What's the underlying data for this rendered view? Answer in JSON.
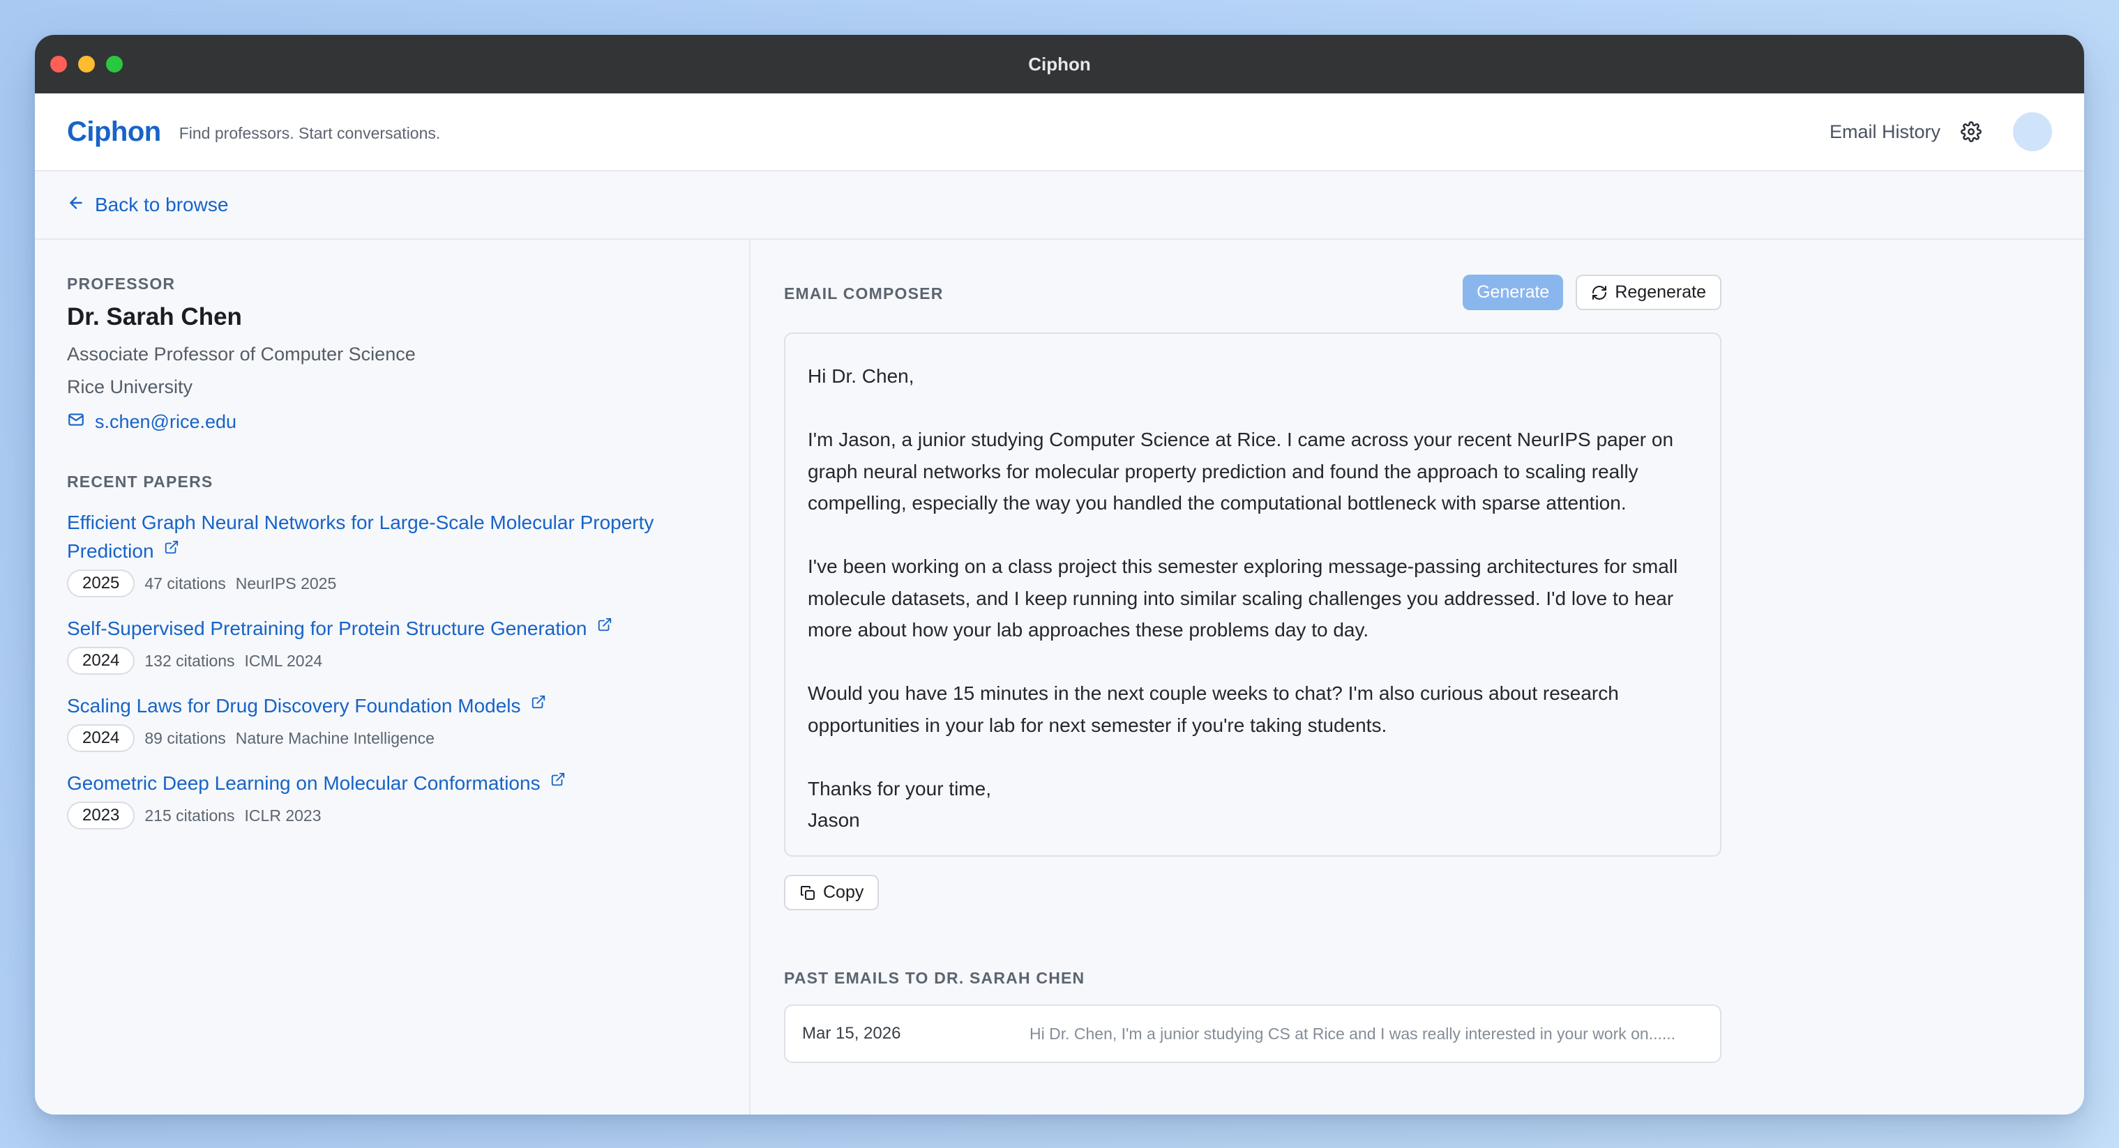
{
  "window": {
    "title": "Ciphon"
  },
  "header": {
    "brand": "Ciphon",
    "tagline": "Find professors. Start conversations.",
    "email_history": "Email History"
  },
  "nav": {
    "back_label": "Back to browse"
  },
  "professor": {
    "section_label": "PROFESSOR",
    "name": "Dr. Sarah Chen",
    "title": "Associate Professor of Computer Science",
    "university": "Rice University",
    "email": "s.chen@rice.edu"
  },
  "papers": {
    "section_label": "RECENT PAPERS",
    "items": [
      {
        "title": "Efficient Graph Neural Networks for Large-Scale Molecular Property Prediction",
        "year": "2025",
        "citations": "47 citations",
        "venue": "NeurIPS 2025"
      },
      {
        "title": "Self-Supervised Pretraining for Protein Structure Generation",
        "year": "2024",
        "citations": "132 citations",
        "venue": "ICML 2024"
      },
      {
        "title": "Scaling Laws for Drug Discovery Foundation Models",
        "year": "2024",
        "citations": "89 citations",
        "venue": "Nature Machine Intelligence"
      },
      {
        "title": "Geometric Deep Learning on Molecular Conformations",
        "year": "2023",
        "citations": "215 citations",
        "venue": "ICLR 2023"
      }
    ]
  },
  "composer": {
    "section_label": "EMAIL COMPOSER",
    "generate_label": "Generate",
    "regenerate_label": "Regenerate",
    "copy_label": "Copy",
    "paragraphs": [
      "Hi Dr. Chen,",
      "I'm Jason, a junior studying Computer Science at Rice. I came across your recent NeurIPS paper on graph neural networks for molecular property prediction and found the approach to scaling really compelling, especially the way you handled the computational bottleneck with sparse attention.",
      "I've been working on a class project this semester exploring message-passing architectures for small molecule datasets, and I keep running into similar scaling challenges you addressed. I'd love to hear more about how your lab approaches these problems day to day.",
      "Would you have 15 minutes in the next couple weeks to chat? I'm also curious about research opportunities in your lab for next semester if you're taking students.",
      "Thanks for your time,",
      "Jason"
    ]
  },
  "past_emails": {
    "section_label": "PAST EMAILS TO DR. SARAH CHEN",
    "items": [
      {
        "date": "Mar 15, 2026",
        "preview": "Hi Dr. Chen, I'm a junior studying CS at Rice and I was really interested in your work on......"
      }
    ]
  },
  "colors": {
    "accent": "#1763c8",
    "generate_button": "#8ab6ee",
    "titlebar": "#333436",
    "background_gradient_start": "#a9c9f2"
  },
  "icons": {
    "back": "arrow-left-icon",
    "settings": "gear-icon",
    "email": "mail-icon",
    "external": "external-link-icon",
    "regenerate": "refresh-icon",
    "copy": "copy-icon"
  }
}
